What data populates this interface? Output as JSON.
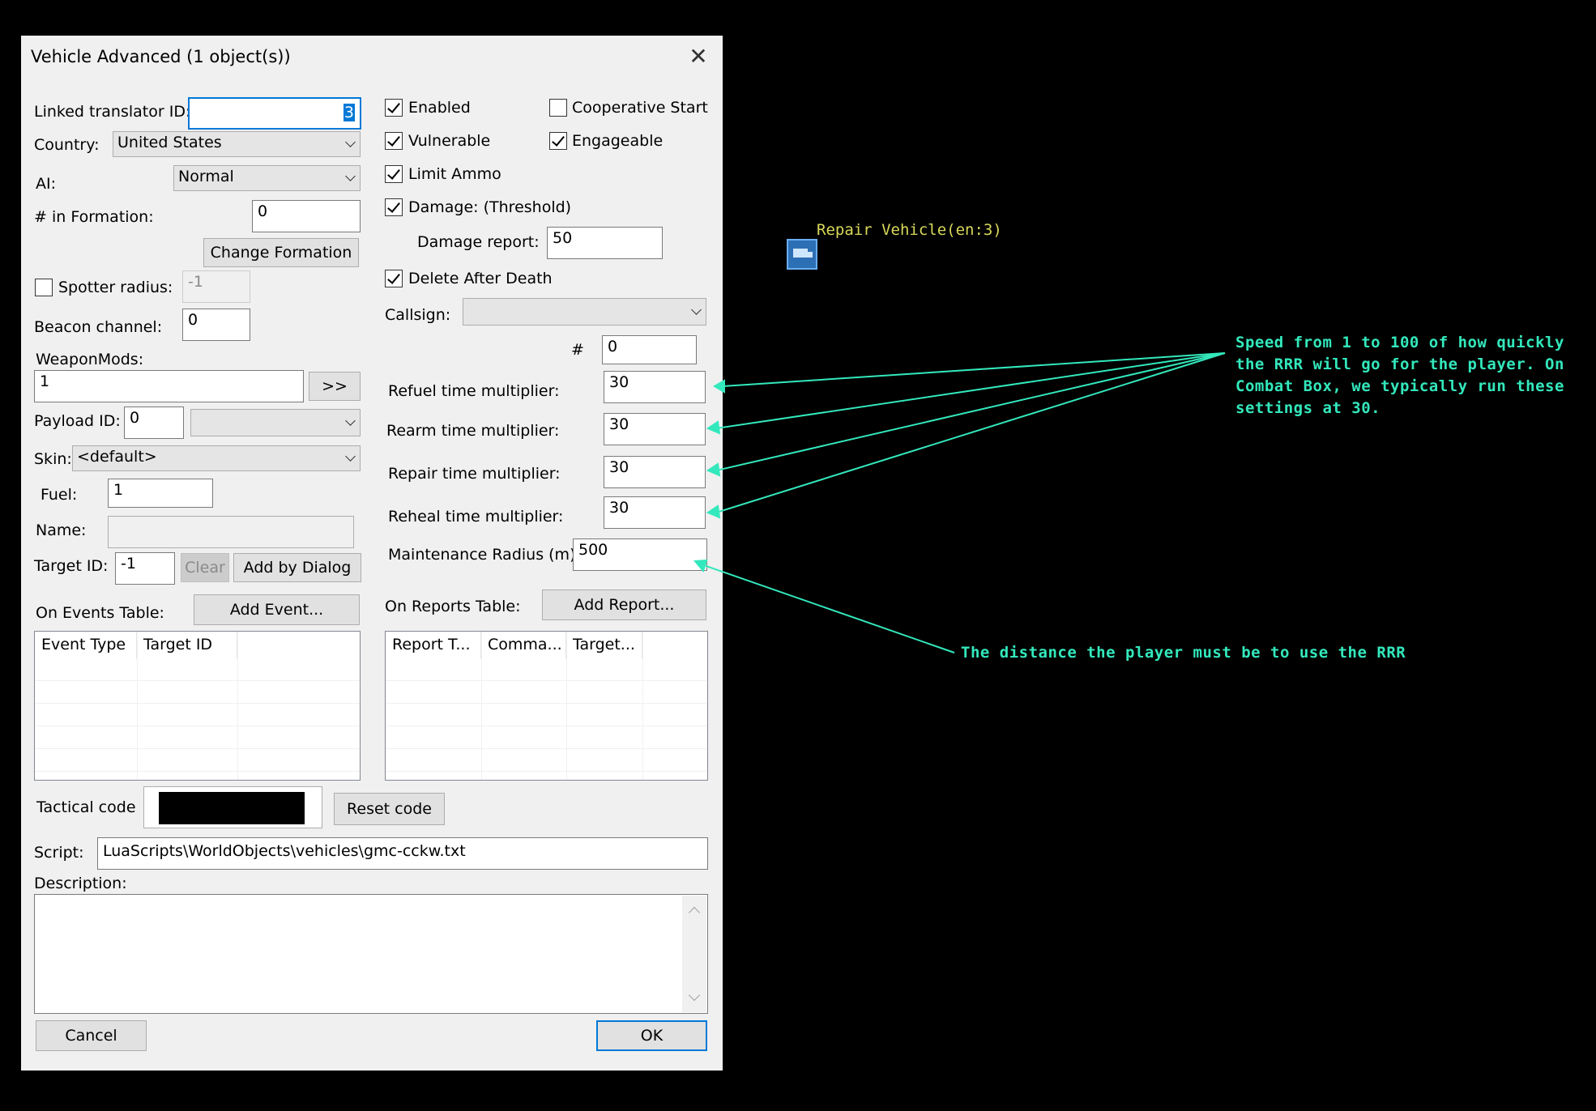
{
  "dialog": {
    "title": "Vehicle Advanced (1 object(s))",
    "close_glyph": "✕",
    "left": {
      "linked_translator_label": "Linked translator ID:",
      "linked_translator_value": "3",
      "country_label": "Country:",
      "country_value": "United States",
      "ai_label": "AI:",
      "ai_value": "Normal",
      "formation_label": "# in Formation:",
      "formation_value": "0",
      "change_formation_button": "Change Formation",
      "spotter_label": "Spotter radius:",
      "spotter_checked": false,
      "spotter_value": "-1",
      "beacon_label": "Beacon channel:",
      "beacon_value": "0",
      "weaponmods_label": "WeaponMods:",
      "weaponmods_value": "1",
      "weaponmods_button": ">>",
      "payload_label": "Payload ID:",
      "payload_value": "0",
      "payload_select_value": "",
      "skin_label": "Skin:",
      "skin_value": "<default>",
      "fuel_label": "Fuel:",
      "fuel_value": "1",
      "name_label": "Name:",
      "name_value": "",
      "target_label": "Target ID:",
      "target_value": "-1",
      "clear_button": "Clear",
      "add_by_dialog_button": "Add by Dialog",
      "events_label": "On Events Table:",
      "add_event_button": "Add Event...",
      "events_columns": [
        "Event Type",
        "Target ID",
        ""
      ]
    },
    "right": {
      "enabled_label": "Enabled",
      "enabled_checked": true,
      "coop_label": "Cooperative Start",
      "coop_checked": false,
      "vulnerable_label": "Vulnerable",
      "vulnerable_checked": true,
      "engageable_label": "Engageable",
      "engageable_checked": true,
      "limit_ammo_label": "Limit Ammo",
      "limit_ammo_checked": true,
      "damage_label": "Damage: (Threshold)",
      "damage_checked": true,
      "damage_report_label": "Damage report:",
      "damage_report_value": "50",
      "delete_after_death_label": "Delete After Death",
      "delete_after_death_checked": true,
      "callsign_label": "Callsign:",
      "callsign_value": "",
      "hash_label": "#",
      "hash_value": "0",
      "refuel_label": "Refuel time multiplier:",
      "refuel_value": "30",
      "rearm_label": "Rearm time multiplier:",
      "rearm_value": "30",
      "repair_label": "Repair time multiplier:",
      "repair_value": "30",
      "reheal_label": "Reheal time multiplier:",
      "reheal_value": "30",
      "maintenance_label": "Maintenance Radius (m):",
      "maintenance_value": "500",
      "reports_label": "On Reports Table:",
      "add_report_button": "Add Report...",
      "reports_columns": [
        "Report T...",
        "Comma...",
        "Target...",
        ""
      ]
    },
    "bottom": {
      "tactical_label": "Tactical code",
      "reset_code_button": "Reset code",
      "script_label": "Script:",
      "script_value": "LuaScripts\\WorldObjects\\vehicles\\gmc-cckw.txt",
      "description_label": "Description:",
      "description_value": "",
      "cancel_button": "Cancel",
      "ok_button": "OK"
    }
  },
  "map": {
    "object_label": "Repair Vehicle(en:3)",
    "object_icon": "truck-icon"
  },
  "annotations": {
    "speed_note": "Speed from 1 to 100 of how quickly the RRR will go for the player. On Combat Box, we typically run these settings at 30.",
    "distance_note": "The distance the player must be to use the RRR",
    "color": "#33e8bc"
  },
  "colors": {
    "background": "#000000",
    "dialog_bg": "#f0f0f0",
    "focus_border": "#0078d7",
    "map_label": "#d8d85a"
  }
}
